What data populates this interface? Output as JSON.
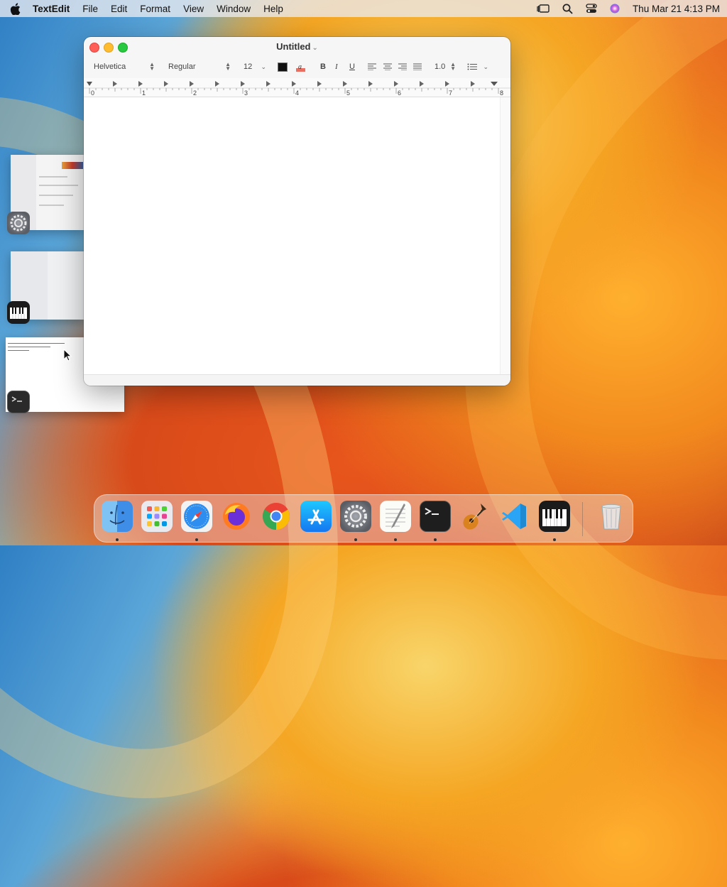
{
  "menubar": {
    "app_name": "TextEdit",
    "menus": [
      "File",
      "Edit",
      "Format",
      "View",
      "Window",
      "Help"
    ],
    "clock": "Thu Mar 21  4:13 PM"
  },
  "window": {
    "title": "Untitled",
    "toolbar": {
      "font": "Helvetica",
      "style": "Regular",
      "size": "12",
      "bold": "B",
      "italic": "I",
      "underline": "U",
      "line_spacing": "1.0"
    },
    "ruler": {
      "labels": [
        "0",
        "1",
        "2",
        "3",
        "4",
        "5",
        "6",
        "7",
        "8"
      ]
    }
  },
  "stage_manager": {
    "groups": [
      {
        "app": "System Settings",
        "icon": "gear-icon"
      },
      {
        "app": "Piano",
        "icon": "piano-icon"
      },
      {
        "app": "Terminal",
        "icon": "terminal-icon"
      }
    ]
  },
  "dock": {
    "apps": [
      {
        "name": "Finder",
        "icon": "finder-icon",
        "running": true
      },
      {
        "name": "Launchpad",
        "icon": "launchpad-icon",
        "running": false
      },
      {
        "name": "Safari",
        "icon": "safari-icon",
        "running": true
      },
      {
        "name": "Firefox",
        "icon": "firefox-icon",
        "running": false
      },
      {
        "name": "Google Chrome",
        "icon": "chrome-icon",
        "running": false
      },
      {
        "name": "App Store",
        "icon": "app-store-icon",
        "running": false
      },
      {
        "name": "System Settings",
        "icon": "gear-icon",
        "running": true
      },
      {
        "name": "TextEdit",
        "icon": "textedit-icon",
        "running": true
      },
      {
        "name": "Terminal",
        "icon": "terminal-icon",
        "running": true
      },
      {
        "name": "GarageBand",
        "icon": "guitar-icon",
        "running": false
      },
      {
        "name": "Visual Studio Code",
        "icon": "vscode-icon",
        "running": false
      },
      {
        "name": "Piano",
        "icon": "piano-icon",
        "running": true
      },
      {
        "name": "Trash",
        "icon": "trash-icon",
        "running": false
      }
    ]
  }
}
